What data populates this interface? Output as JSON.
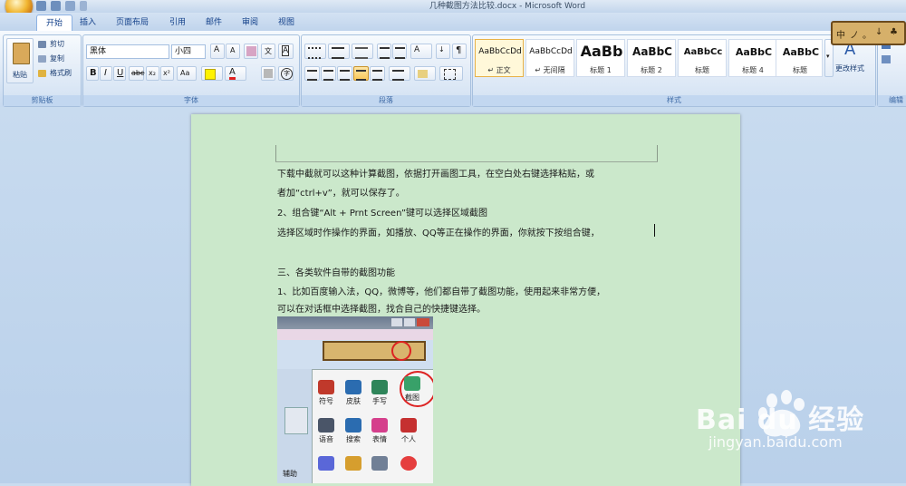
{
  "window": {
    "title": "几种截图方法比较.docx - Microsoft Word"
  },
  "tabs": [
    {
      "label": "开始",
      "active": true
    },
    {
      "label": "插入"
    },
    {
      "label": "页面布局"
    },
    {
      "label": "引用"
    },
    {
      "label": "邮件"
    },
    {
      "label": "审阅"
    },
    {
      "label": "视图"
    }
  ],
  "ribbon": {
    "clipboard": {
      "paste": "粘贴",
      "cut": "剪切",
      "copy": "复制",
      "format_painter": "格式刷",
      "label": "剪贴板"
    },
    "font": {
      "font_name": "黑体",
      "font_size": "小四",
      "label": "字体"
    },
    "paragraph": {
      "label": "段落"
    },
    "styles": {
      "label": "样式",
      "tiles": [
        {
          "preview": "AaBbCcDd",
          "name": "↵ 正文",
          "selected": true
        },
        {
          "preview": "AaBbCcDd",
          "name": "↵ 无间隔"
        },
        {
          "preview": "AaBb",
          "name": "标题 1"
        },
        {
          "preview": "AaBbC",
          "name": "标题 2"
        },
        {
          "preview": "AaBbCc",
          "name": "标题"
        },
        {
          "preview": "AaBbC",
          "name": "标题 4"
        },
        {
          "preview": "AaBbC",
          "name": "标题"
        }
      ],
      "change_styles": "更改样式"
    },
    "editing": {
      "label": "编辑"
    }
  },
  "ime_toolbar": {
    "chars": [
      "中",
      "ノ",
      "。",
      "↓",
      "♣"
    ]
  },
  "document": {
    "lines": [
      "下载中截就可以这种计算截图，依据打开画图工具，在空白处右键选择粘贴，或",
      "者加“ctrl+v”，就可以保存了。",
      "2、组合键“Alt + Prnt Screen”键可以选择区域截图",
      "选择区域时作操作的界面，如播放、QQ等正在操作的界面，你就按下按组合键，",
      "",
      "三、各类软件自带的截图功能",
      "1、比如百度输入法，QQ，微博等，他们都自带了截图功能，使用起来非常方便，",
      "可以在对话框中选择截图，找合自己的快捷键选择。"
    ]
  },
  "embedded_screenshot": {
    "icons": [
      {
        "label": "符号",
        "color": "#c0392b"
      },
      {
        "label": "皮肤",
        "color": "#2b6cb0"
      },
      {
        "label": "手写",
        "color": "#2f855a"
      },
      {
        "label": "截图",
        "color": "#38a169"
      },
      {
        "label": "语音",
        "color": "#4a5568"
      },
      {
        "label": "搜索",
        "color": "#2b6cb0"
      },
      {
        "label": "表情",
        "color": "#d53f8c"
      },
      {
        "label": "个人",
        "color": "#c53030"
      }
    ],
    "side_text": "辅助"
  },
  "watermark": {
    "brand": "Bai du 经验",
    "url": "jingyan.baidu.com"
  }
}
